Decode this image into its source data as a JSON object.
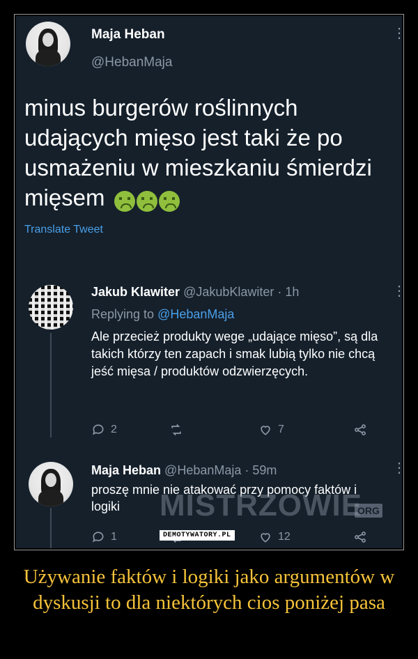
{
  "tweet": {
    "author_name": "Maja Heban",
    "author_handle": "@HebanMaja",
    "text": "minus burgerów roślinnych udających mięso jest taki że po usmażeniu w mieszkaniu śmierdzi mięsem",
    "emojis": [
      "nauseated-face",
      "nauseated-face",
      "nauseated-face"
    ],
    "translate_label": "Translate Tweet"
  },
  "reply1": {
    "author_name": "Jakub Klawiter",
    "meta": "@JakubKlawiter · 1h",
    "replying_prefix": "Replying to ",
    "replying_handle": "@HebanMaja",
    "text": "Ale przecież produkty wege „udające mięso”, są dla takich którzy ten zapach i smak lubią tylko nie chcą jeść mięsa / produktów odzwierzęcych.",
    "replies": "2",
    "retweets": "",
    "likes": "7"
  },
  "reply2": {
    "author_name": "Maja Heban",
    "meta": "@HebanMaja · 59m",
    "text": "proszę mnie nie atakować przy pomocy faktów i logiki",
    "replies": "1",
    "retweets": "",
    "likes": "12"
  },
  "watermark": {
    "text": "MISTRZOWIE",
    "suffix": "ORG"
  },
  "badge": "DEMOTYWATORY.PL",
  "caption": "Używanie faktów i logiki jako argumentów w dyskusji to dla niektórych cios poniżej pasa",
  "colors": {
    "background": "#15202b",
    "link": "#4a9fe8",
    "muted": "#8b98a5",
    "caption": "#f6c33a"
  }
}
